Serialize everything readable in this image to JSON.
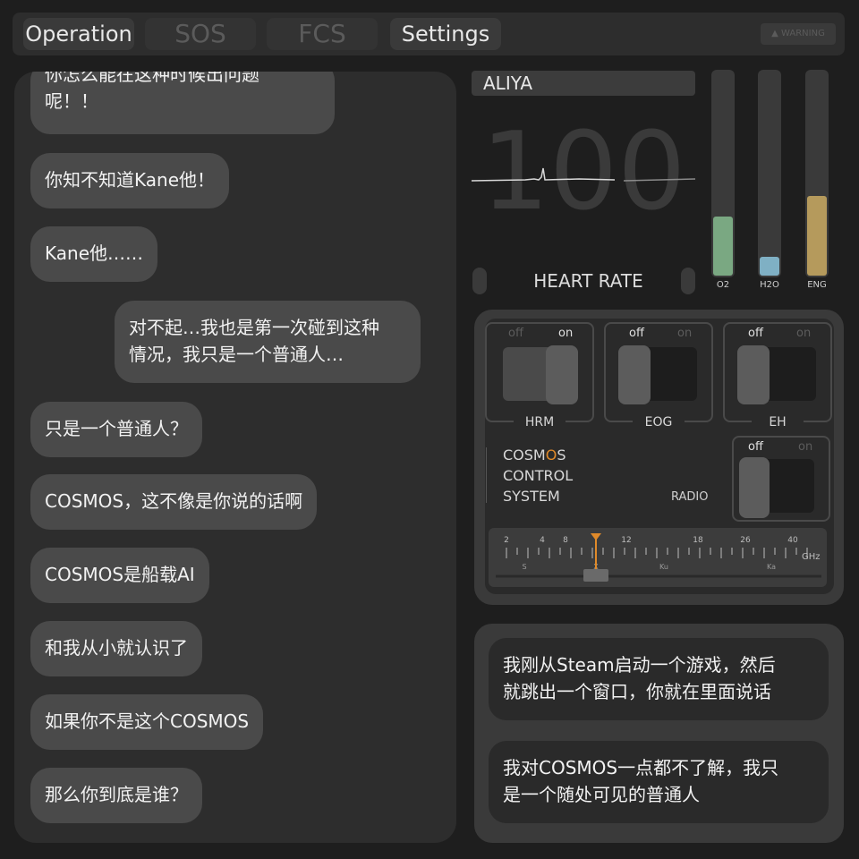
{
  "tabs": [
    {
      "label": "Operation",
      "active": true
    },
    {
      "label": "SOS",
      "active": false
    },
    {
      "label": "FCS",
      "active": false
    },
    {
      "label": "Settings",
      "active": true
    }
  ],
  "warning_label": "WARNING",
  "chat": {
    "messages": [
      {
        "text": "你怎么能在这种时候出问题\n呢！！",
        "side": "left"
      },
      {
        "text": "你知不知道Kane他！",
        "side": "left"
      },
      {
        "text": "Kane他……",
        "side": "left"
      },
      {
        "text": "对不起…我也是第一次碰到这种\n情况，我只是一个普通人…",
        "side": "right"
      },
      {
        "text": "只是一个普通人？",
        "side": "left"
      },
      {
        "text": "COSMOS，这不像是你说的话啊",
        "side": "left"
      },
      {
        "text": "COSMOS是船载AI",
        "side": "left"
      },
      {
        "text": "和我从小就认识了",
        "side": "left"
      },
      {
        "text": "如果你不是这个COSMOS",
        "side": "left"
      },
      {
        "text": "那么你到底是谁？",
        "side": "left"
      }
    ]
  },
  "monitor": {
    "name": "ALIYA",
    "heart_rate_value": "100",
    "heart_rate_label": "HEART RATE"
  },
  "gauges": [
    {
      "label": "O2",
      "level": 0.29,
      "color": "#7aa882"
    },
    {
      "label": "H2O",
      "level": 0.09,
      "color": "#7fb0c4"
    },
    {
      "label": "ENG",
      "level": 0.39,
      "color": "#b59a5c"
    }
  ],
  "switches": [
    {
      "name": "HRM",
      "off": "off",
      "on": "on",
      "state": "on"
    },
    {
      "name": "EOG",
      "off": "off",
      "on": "on",
      "state": "off"
    },
    {
      "name": "EH",
      "off": "off",
      "on": "on",
      "state": "off"
    },
    {
      "name": "RADIO",
      "off": "off",
      "on": "on",
      "state": "off"
    }
  ],
  "control_system": {
    "line1_pre": "COSM",
    "line1_highlight": "O",
    "line1_post": "S",
    "line2": "CONTROL",
    "line3": "SYSTEM",
    "radio_label": "RADIO"
  },
  "tuner": {
    "ticks": [
      "2",
      "4",
      "8",
      "12",
      "18",
      "26",
      "40"
    ],
    "bands": [
      "S",
      "X",
      "Ku",
      "Ka"
    ],
    "unit": "GHz",
    "needle_ghz": 10
  },
  "replies": [
    {
      "text": "我刚从Steam启动一个游戏，然后\n就跳出一个窗口，你就在里面说话"
    },
    {
      "text": "我对COSMOS一点都不了解，我只\n是一个随处可见的普通人"
    }
  ],
  "colors": {
    "accent_orange": "#e08a2a"
  }
}
